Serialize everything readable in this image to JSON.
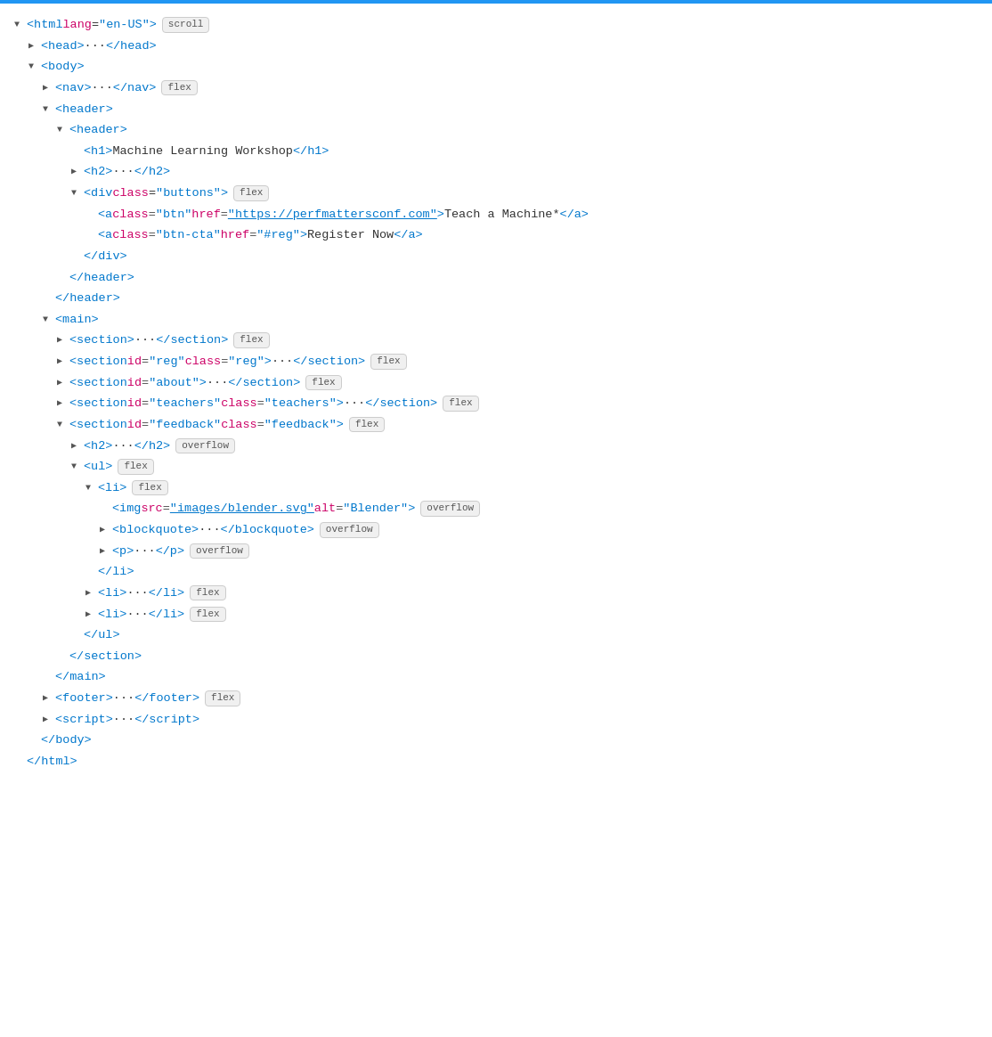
{
  "topbar": {
    "color": "#2196F3"
  },
  "lines": [
    {
      "id": "line-html",
      "indent": 0,
      "triangle": "down",
      "content": "<html lang=\"en-US\">",
      "badge": "scroll"
    },
    {
      "id": "line-head",
      "indent": 1,
      "triangle": "right",
      "content": "<head>···</head>"
    },
    {
      "id": "line-body-open",
      "indent": 1,
      "triangle": "down",
      "content": "<body>"
    },
    {
      "id": "line-nav",
      "indent": 2,
      "triangle": "right",
      "content": "<nav>···</nav>",
      "badge": "flex"
    },
    {
      "id": "line-header-outer-open",
      "indent": 2,
      "triangle": "down",
      "content": "<header>"
    },
    {
      "id": "line-header-inner-open",
      "indent": 3,
      "triangle": "down",
      "content": "<header>"
    },
    {
      "id": "line-h1",
      "indent": 4,
      "triangle": null,
      "content": "<h1>Machine Learning Workshop</h1>"
    },
    {
      "id": "line-h2",
      "indent": 4,
      "triangle": "right",
      "content": "<h2>···</h2>"
    },
    {
      "id": "line-div-buttons",
      "indent": 4,
      "triangle": "down",
      "content": "<div class=\"buttons\">",
      "badge": "flex"
    },
    {
      "id": "line-a-btn",
      "indent": 5,
      "triangle": null,
      "content_parts": [
        {
          "type": "tag",
          "text": "<a"
        },
        {
          "type": "space",
          "text": " "
        },
        {
          "type": "attr-name",
          "text": "class"
        },
        {
          "type": "punctuation",
          "text": "="
        },
        {
          "type": "attr-value",
          "text": "\"btn\""
        },
        {
          "type": "space",
          "text": " "
        },
        {
          "type": "attr-name",
          "text": "href"
        },
        {
          "type": "punctuation",
          "text": "="
        },
        {
          "type": "attr-value-link",
          "text": "\"https://perfmattersconf.com\""
        },
        {
          "type": "tag",
          "text": ">"
        },
        {
          "type": "text",
          "text": "Teach a Machine*"
        },
        {
          "type": "closing-tag",
          "text": "</a>"
        }
      ]
    },
    {
      "id": "line-a-btn-cta",
      "indent": 5,
      "triangle": null,
      "content_parts": [
        {
          "type": "tag",
          "text": "<a"
        },
        {
          "type": "space",
          "text": " "
        },
        {
          "type": "attr-name",
          "text": "class"
        },
        {
          "type": "punctuation",
          "text": "="
        },
        {
          "type": "attr-value",
          "text": "\"btn-cta\""
        },
        {
          "type": "space",
          "text": " "
        },
        {
          "type": "attr-name",
          "text": "href"
        },
        {
          "type": "punctuation",
          "text": "="
        },
        {
          "type": "attr-value",
          "text": "\"#reg\""
        },
        {
          "type": "tag",
          "text": ">"
        },
        {
          "type": "text",
          "text": "Register Now"
        },
        {
          "type": "closing-tag",
          "text": "</a>"
        }
      ]
    },
    {
      "id": "line-div-close",
      "indent": 4,
      "triangle": null,
      "content": "</div>"
    },
    {
      "id": "line-header-inner-close",
      "indent": 3,
      "triangle": null,
      "content": "</header>"
    },
    {
      "id": "line-header-outer-close",
      "indent": 2,
      "triangle": null,
      "content": "</header>"
    },
    {
      "id": "line-main-open",
      "indent": 2,
      "triangle": "down",
      "content": "<main>"
    },
    {
      "id": "line-section-1",
      "indent": 3,
      "triangle": "right",
      "content": "<section>···</section>",
      "badge": "flex"
    },
    {
      "id": "line-section-reg",
      "indent": 3,
      "triangle": "right",
      "content_parts": [
        {
          "type": "tag",
          "text": "<section"
        },
        {
          "type": "space",
          "text": " "
        },
        {
          "type": "attr-name",
          "text": "id"
        },
        {
          "type": "punctuation",
          "text": "="
        },
        {
          "type": "attr-value",
          "text": "\"reg\""
        },
        {
          "type": "space",
          "text": " "
        },
        {
          "type": "attr-name",
          "text": "class"
        },
        {
          "type": "punctuation",
          "text": "="
        },
        {
          "type": "attr-value",
          "text": "\"reg\""
        },
        {
          "type": "tag",
          "text": ">"
        },
        {
          "type": "text",
          "text": "···"
        },
        {
          "type": "closing-tag",
          "text": "</section>"
        }
      ],
      "badge": "flex"
    },
    {
      "id": "line-section-about",
      "indent": 3,
      "triangle": "right",
      "content_parts": [
        {
          "type": "tag",
          "text": "<section"
        },
        {
          "type": "space",
          "text": " "
        },
        {
          "type": "attr-name",
          "text": "id"
        },
        {
          "type": "punctuation",
          "text": "="
        },
        {
          "type": "attr-value",
          "text": "\"about\""
        },
        {
          "type": "tag",
          "text": ">"
        },
        {
          "type": "text",
          "text": "···"
        },
        {
          "type": "closing-tag",
          "text": "</section>"
        }
      ],
      "badge": "flex"
    },
    {
      "id": "line-section-teachers",
      "indent": 3,
      "triangle": "right",
      "content_parts": [
        {
          "type": "tag",
          "text": "<section"
        },
        {
          "type": "space",
          "text": " "
        },
        {
          "type": "attr-name",
          "text": "id"
        },
        {
          "type": "punctuation",
          "text": "="
        },
        {
          "type": "attr-value",
          "text": "\"teachers\""
        },
        {
          "type": "space",
          "text": " "
        },
        {
          "type": "attr-name",
          "text": "class"
        },
        {
          "type": "punctuation",
          "text": "="
        },
        {
          "type": "attr-value",
          "text": "\"teachers\""
        },
        {
          "type": "tag",
          "text": ">"
        },
        {
          "type": "text",
          "text": "···"
        },
        {
          "type": "closing-tag",
          "text": "</section>"
        }
      ],
      "badge": "flex"
    },
    {
      "id": "line-section-feedback-open",
      "indent": 3,
      "triangle": "down",
      "content_parts": [
        {
          "type": "tag",
          "text": "<section"
        },
        {
          "type": "space",
          "text": " "
        },
        {
          "type": "attr-name",
          "text": "id"
        },
        {
          "type": "punctuation",
          "text": "="
        },
        {
          "type": "attr-value",
          "text": "\"feedback\""
        },
        {
          "type": "space",
          "text": " "
        },
        {
          "type": "attr-name",
          "text": "class"
        },
        {
          "type": "punctuation",
          "text": "="
        },
        {
          "type": "attr-value",
          "text": "\"feedback\""
        },
        {
          "type": "tag",
          "text": ">"
        }
      ],
      "badge": "flex"
    },
    {
      "id": "line-h2-feedback",
      "indent": 4,
      "triangle": "right",
      "content": "<h2>···</h2>",
      "badge": "overflow"
    },
    {
      "id": "line-ul-open",
      "indent": 4,
      "triangle": "down",
      "content": "<ul>",
      "badge": "flex"
    },
    {
      "id": "line-li-open",
      "indent": 5,
      "triangle": "down",
      "content": "<li>",
      "badge": "flex"
    },
    {
      "id": "line-img",
      "indent": 6,
      "triangle": null,
      "content_parts": [
        {
          "type": "tag",
          "text": "<img"
        },
        {
          "type": "space",
          "text": " "
        },
        {
          "type": "attr-name",
          "text": "src"
        },
        {
          "type": "punctuation",
          "text": "="
        },
        {
          "type": "attr-value-link",
          "text": "\"images/blender.svg\""
        },
        {
          "type": "space",
          "text": " "
        },
        {
          "type": "attr-name",
          "text": "alt"
        },
        {
          "type": "punctuation",
          "text": "="
        },
        {
          "type": "attr-value",
          "text": "\"Blender\""
        },
        {
          "type": "tag",
          "text": ">"
        }
      ],
      "badge": "overflow"
    },
    {
      "id": "line-blockquote",
      "indent": 6,
      "triangle": "right",
      "content": "<blockquote>···</blockquote>",
      "badge": "overflow"
    },
    {
      "id": "line-p",
      "indent": 6,
      "triangle": "right",
      "content": "<p>···</p>",
      "badge": "overflow"
    },
    {
      "id": "line-li-close",
      "indent": 5,
      "triangle": null,
      "content": "</li>"
    },
    {
      "id": "line-li-2",
      "indent": 5,
      "triangle": "right",
      "content": "<li>···</li>",
      "badge": "flex"
    },
    {
      "id": "line-li-3",
      "indent": 5,
      "triangle": "right",
      "content": "<li>···</li>",
      "badge": "flex"
    },
    {
      "id": "line-ul-close",
      "indent": 4,
      "triangle": null,
      "content": "</ul>"
    },
    {
      "id": "line-section-feedback-close",
      "indent": 3,
      "triangle": null,
      "content": "</section>"
    },
    {
      "id": "line-main-close",
      "indent": 2,
      "triangle": null,
      "content": "</main>"
    },
    {
      "id": "line-footer",
      "indent": 2,
      "triangle": "right",
      "content": "<footer>···</footer>",
      "badge": "flex"
    },
    {
      "id": "line-script",
      "indent": 2,
      "triangle": "right",
      "content": "<script>···</script>"
    },
    {
      "id": "line-body-close",
      "indent": 1,
      "triangle": null,
      "content": "</body>"
    },
    {
      "id": "line-html-close",
      "indent": 0,
      "triangle": null,
      "content": "</html>"
    }
  ]
}
